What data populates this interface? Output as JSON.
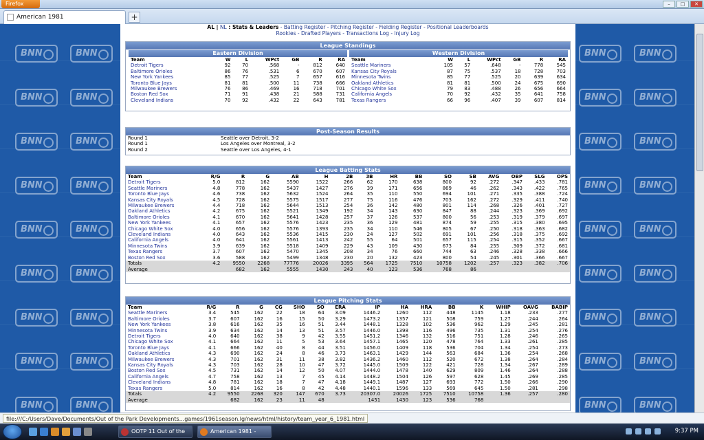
{
  "browser": {
    "menu_button": "Firefox",
    "tab_title": "American 1981",
    "new_tab": "+",
    "window_controls": [
      "–",
      "□",
      "✕"
    ]
  },
  "nav": {
    "line1_prefix": "AL | ",
    "line1_nl": "NL",
    "line1_title": " : Stats & Leaders",
    "line1_links": " - Batting Register - Pitching Register - Fielding Register - Positional Leaderboards",
    "line2": "Rookies - Drafted Players - Transactions Log - Injury Log"
  },
  "standings": {
    "title": "League Standings",
    "headers": [
      "Team",
      "W",
      "L",
      "WPct",
      "GB",
      "R",
      "RA"
    ],
    "east": {
      "title": "Eastern Division",
      "rows": [
        [
          "Detroit Tigers",
          "92",
          "70",
          ".568",
          "-",
          "812",
          "640"
        ],
        [
          "Baltimore Orioles",
          "86",
          "76",
          ".531",
          "6",
          "670",
          "607"
        ],
        [
          "New York Yankees",
          "85",
          "77",
          ".525",
          "7",
          "657",
          "616"
        ],
        [
          "Toronto Blue Jays",
          "81",
          "81",
          ".500",
          "11",
          "738",
          "666"
        ],
        [
          "Milwaukee Brewers",
          "76",
          "86",
          ".469",
          "16",
          "718",
          "701"
        ],
        [
          "Boston Red Sox",
          "71",
          "91",
          ".438",
          "21",
          "588",
          "731"
        ],
        [
          "Cleveland Indians",
          "70",
          "92",
          ".432",
          "22",
          "643",
          "781"
        ]
      ]
    },
    "west": {
      "title": "Western Division",
      "rows": [
        [
          "Seattle Mariners",
          "105",
          "57",
          ".648",
          "-",
          "778",
          "545"
        ],
        [
          "Kansas City Royals",
          "87",
          "75",
          ".537",
          "18",
          "728",
          "703"
        ],
        [
          "Minnesota Twins",
          "85",
          "77",
          ".525",
          "20",
          "639",
          "634"
        ],
        [
          "Oakland Athletics",
          "81",
          "81",
          ".500",
          "24",
          "675",
          "690"
        ],
        [
          "Chicago White Sox",
          "79",
          "83",
          ".488",
          "26",
          "656",
          "664"
        ],
        [
          "California Angels",
          "70",
          "92",
          ".432",
          "35",
          "641",
          "758"
        ],
        [
          "Texas Rangers",
          "66",
          "96",
          ".407",
          "39",
          "607",
          "814"
        ]
      ]
    }
  },
  "postseason": {
    "title": "Post-Season Results",
    "rows": [
      [
        "Round 1",
        "Seattle over Detroit, 3-2"
      ],
      [
        "Round 1",
        "Los Angeles over Montreal, 3-2"
      ],
      [
        "Round 2",
        "Seattle over Los Angeles, 4-1"
      ]
    ]
  },
  "batting": {
    "title": "League Batting Stats",
    "headers": [
      "Team",
      "R/G",
      "R",
      "G",
      "AB",
      "H",
      "2B",
      "3B",
      "HR",
      "BB",
      "SO",
      "SB",
      "AVG",
      "OBP",
      "SLG",
      "OPS"
    ],
    "rows": [
      [
        "Detroit Tigers",
        "5.0",
        "812",
        "162",
        "5590",
        "1522",
        "266",
        "62",
        "170",
        "638",
        "800",
        "92",
        ".272",
        ".347",
        ".433",
        ".781"
      ],
      [
        "Seattle Mariners",
        "4.8",
        "778",
        "162",
        "5437",
        "1427",
        "276",
        "39",
        "171",
        "656",
        "869",
        "46",
        ".262",
        ".343",
        ".422",
        ".765"
      ],
      [
        "Toronto Blue Jays",
        "4.6",
        "738",
        "162",
        "5632",
        "1524",
        "264",
        "35",
        "110",
        "550",
        "694",
        "101",
        ".271",
        ".335",
        ".388",
        ".724"
      ],
      [
        "Kansas City Royals",
        "4.5",
        "728",
        "162",
        "5575",
        "1517",
        "277",
        "75",
        "116",
        "476",
        "703",
        "162",
        ".272",
        ".329",
        ".411",
        ".740"
      ],
      [
        "Milwaukee Brewers",
        "4.4",
        "718",
        "162",
        "5644",
        "1513",
        "254",
        "36",
        "142",
        "480",
        "801",
        "114",
        ".268",
        ".326",
        ".401",
        ".727"
      ],
      [
        "Oakland Athletics",
        "4.2",
        "675",
        "162",
        "5521",
        "1349",
        "192",
        "34",
        "143",
        "630",
        "847",
        "88",
        ".244",
        ".323",
        ".369",
        ".692"
      ],
      [
        "Baltimore Orioles",
        "4.1",
        "670",
        "162",
        "5641",
        "1428",
        "257",
        "37",
        "126",
        "537",
        "800",
        "56",
        ".253",
        ".319",
        ".379",
        ".697"
      ],
      [
        "New York Yankees",
        "4.1",
        "657",
        "162",
        "5576",
        "1423",
        "235",
        "36",
        "129",
        "481",
        "874",
        "59",
        ".255",
        ".315",
        ".380",
        ".695"
      ],
      [
        "Chicago White Sox",
        "4.0",
        "656",
        "162",
        "5576",
        "1393",
        "235",
        "34",
        "110",
        "546",
        "805",
        "67",
        ".250",
        ".318",
        ".363",
        ".682"
      ],
      [
        "Cleveland Indians",
        "4.0",
        "643",
        "162",
        "5536",
        "1415",
        "230",
        "24",
        "127",
        "502",
        "691",
        "101",
        ".256",
        ".318",
        ".375",
        ".692"
      ],
      [
        "California Angels",
        "4.0",
        "641",
        "162",
        "5561",
        "1413",
        "242",
        "55",
        "64",
        "501",
        "657",
        "115",
        ".254",
        ".315",
        ".352",
        ".667"
      ],
      [
        "Minnesota Twins",
        "3.9",
        "639",
        "162",
        "5518",
        "1409",
        "229",
        "43",
        "109",
        "430",
        "673",
        "84",
        ".255",
        ".309",
        ".372",
        ".681"
      ],
      [
        "Texas Rangers",
        "3.7",
        "607",
        "162",
        "5470",
        "1345",
        "208",
        "34",
        "76",
        "660",
        "744",
        "63",
        ".246",
        ".328",
        ".338",
        ".666"
      ],
      [
        "Boston Red Sox",
        "3.6",
        "588",
        "162",
        "5499",
        "1348",
        "230",
        "20",
        "132",
        "423",
        "800",
        "54",
        ".245",
        ".301",
        ".366",
        ".667"
      ]
    ],
    "totals": [
      "Totals",
      "4.2",
      "9550",
      "2268",
      "77776",
      "20026",
      "3395",
      "564",
      "1725",
      "7510",
      "10758",
      "1202",
      ".257",
      ".323",
      ".382",
      ".706"
    ],
    "average": [
      "Average",
      "",
      "682",
      "162",
      "5555",
      "1430",
      "243",
      "40",
      "123",
      "536",
      "768",
      "86",
      "",
      "",
      "",
      ""
    ]
  },
  "pitching": {
    "title": "League Pitching Stats",
    "headers": [
      "Team",
      "R/G",
      "R",
      "G",
      "CG",
      "SHO",
      "SO",
      "ERA",
      "IP",
      "HA",
      "HRA",
      "BB",
      "K",
      "WHIP",
      "OAVG",
      "BABIP"
    ],
    "rows": [
      [
        "Seattle Mariners",
        "3.4",
        "545",
        "162",
        "22",
        "18",
        "64",
        "3.09",
        "1446.2",
        "1260",
        "112",
        "448",
        "1145",
        "1.18",
        ".233",
        ".277"
      ],
      [
        "Baltimore Orioles",
        "3.7",
        "607",
        "162",
        "16",
        "15",
        "50",
        "3.29",
        "1473.2",
        "1357",
        "121",
        "508",
        "759",
        "1.27",
        ".244",
        ".264"
      ],
      [
        "New York Yankees",
        "3.8",
        "616",
        "162",
        "35",
        "16",
        "51",
        "3.44",
        "1448.1",
        "1328",
        "102",
        "536",
        "962",
        "1.29",
        ".245",
        ".281"
      ],
      [
        "Minnesota Twins",
        "3.9",
        "634",
        "162",
        "14",
        "13",
        "51",
        "3.57",
        "1446.0",
        "1398",
        "116",
        "496",
        "735",
        "1.31",
        ".254",
        ".276"
      ],
      [
        "Detroit Tigers",
        "4.0",
        "640",
        "162",
        "38",
        "9",
        "42",
        "3.55",
        "1451.2",
        "1346",
        "132",
        "516",
        "751",
        "1.28",
        ".246",
        ".265"
      ],
      [
        "Chicago White Sox",
        "4.1",
        "664",
        "162",
        "11",
        "5",
        "53",
        "3.64",
        "1457.1",
        "1465",
        "120",
        "478",
        "764",
        "1.33",
        ".261",
        ".285"
      ],
      [
        "Toronto Blue Jays",
        "4.1",
        "666",
        "162",
        "40",
        "8",
        "44",
        "3.51",
        "1456.0",
        "1409",
        "118",
        "536",
        "704",
        "1.34",
        ".254",
        ".273"
      ],
      [
        "Oakland Athletics",
        "4.3",
        "690",
        "162",
        "24",
        "8",
        "46",
        "3.73",
        "1463.1",
        "1429",
        "144",
        "563",
        "684",
        "1.36",
        ".254",
        ".268"
      ],
      [
        "Milwaukee Brewers",
        "4.3",
        "701",
        "162",
        "31",
        "11",
        "38",
        "3.82",
        "1436.2",
        "1460",
        "112",
        "520",
        "672",
        "1.38",
        ".264",
        ".284"
      ],
      [
        "Kansas City Royals",
        "4.3",
        "703",
        "162",
        "28",
        "10",
        "47",
        "3.72",
        "1445.0",
        "1509",
        "122",
        "421",
        "728",
        "1.34",
        ".267",
        ".289"
      ],
      [
        "Boston Red Sox",
        "4.5",
        "731",
        "162",
        "14",
        "12",
        "50",
        "4.07",
        "1444.0",
        "1478",
        "140",
        "629",
        "809",
        "1.46",
        ".264",
        ".288"
      ],
      [
        "California Angels",
        "4.7",
        "758",
        "162",
        "13",
        "7",
        "45",
        "4.14",
        "1448.2",
        "1504",
        "126",
        "597",
        "628",
        "1.45",
        ".269",
        ".285"
      ],
      [
        "Cleveland Indians",
        "4.8",
        "781",
        "162",
        "18",
        "7",
        "47",
        "4.18",
        "1449.1",
        "1487",
        "127",
        "693",
        "772",
        "1.50",
        ".266",
        ".290"
      ],
      [
        "Texas Rangers",
        "5.0",
        "814",
        "162",
        "16",
        "8",
        "42",
        "4.48",
        "1440.1",
        "1596",
        "133",
        "569",
        "645",
        "1.50",
        ".281",
        ".298"
      ]
    ],
    "totals": [
      "Totals",
      "4.2",
      "9550",
      "2268",
      "320",
      "147",
      "670",
      "3.73",
      "20307.0",
      "20026",
      "1725",
      "7510",
      "10758",
      "1.36",
      ".257",
      ".280"
    ],
    "average": [
      "Average",
      "",
      "682",
      "162",
      "23",
      "11",
      "48",
      "",
      "1451",
      "1430",
      "123",
      "536",
      "768",
      "",
      "",
      ""
    ]
  },
  "status": {
    "url": "file:///C:/Users/Dave/Documents/Out of the Park Developments...games/1961season.lg/news/html/history/team_year_6_1981.html"
  },
  "taskbar": {
    "buttons": [
      "OOTP 11 Out of the ...",
      "American 1981 - Mo..."
    ],
    "clock": "9:37 PM"
  },
  "watermark": "BNN",
  "colors": {
    "header_blue": "#5677b4",
    "link": "#22339a",
    "bg_blue": "#1f5aa7"
  }
}
